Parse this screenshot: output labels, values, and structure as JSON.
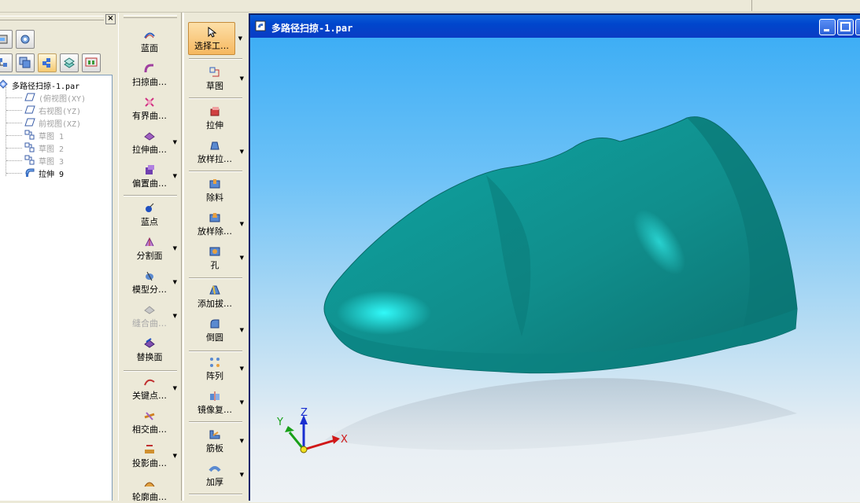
{
  "window": {
    "title": "多路径扫掠-1.par"
  },
  "pathfinder": {
    "tree": {
      "root": "多路径扫掠-1.par",
      "items": [
        {
          "label": "(俯视图(XY)",
          "dim": true,
          "icon": "plane-icon"
        },
        {
          "label": "右视图(YZ)",
          "dim": true,
          "icon": "plane-icon"
        },
        {
          "label": "前视图(XZ)",
          "dim": true,
          "icon": "plane-icon"
        },
        {
          "label": "草图 1",
          "dim": true,
          "icon": "sketch-icon"
        },
        {
          "label": "草图 2",
          "dim": true,
          "icon": "sketch-icon"
        },
        {
          "label": "草图 3",
          "dim": true,
          "icon": "sketch-icon"
        },
        {
          "label": "拉伸 9",
          "dim": false,
          "icon": "extrude-feature-icon"
        }
      ]
    }
  },
  "surface_toolbar": {
    "items": [
      {
        "label": "蓝面",
        "dropdown": false
      },
      {
        "label": "扫掠曲…",
        "dropdown": false
      },
      {
        "label": "有界曲…",
        "dropdown": false
      },
      {
        "label": "拉伸曲…",
        "dropdown": true
      },
      {
        "label": "偏置曲…",
        "dropdown": true
      },
      {
        "label": "蓝点",
        "dropdown": false
      },
      {
        "label": "分割面",
        "dropdown": true
      },
      {
        "label": "模型分…",
        "dropdown": true
      },
      {
        "label": "缝合曲…",
        "dropdown": true,
        "disabled": true
      },
      {
        "label": "替换面",
        "dropdown": false
      },
      {
        "label": "关键点…",
        "dropdown": true
      },
      {
        "label": "相交曲…",
        "dropdown": false
      },
      {
        "label": "投影曲…",
        "dropdown": true
      },
      {
        "label": "轮廓曲…",
        "dropdown": false
      }
    ]
  },
  "feature_toolbar": {
    "items": [
      {
        "label": "选择工…",
        "dropdown": true,
        "selected": true
      },
      {
        "label": "草图",
        "dropdown": true
      },
      {
        "label": "拉伸",
        "dropdown": false
      },
      {
        "label": "放样拉…",
        "dropdown": true
      },
      {
        "label": "除料",
        "dropdown": false
      },
      {
        "label": "放样除…",
        "dropdown": true
      },
      {
        "label": "孔",
        "dropdown": true
      },
      {
        "label": "添加拔…",
        "dropdown": false
      },
      {
        "label": "倒圆",
        "dropdown": true
      },
      {
        "label": "阵列",
        "dropdown": true
      },
      {
        "label": "镜像复…",
        "dropdown": true
      },
      {
        "label": "筋板",
        "dropdown": true
      },
      {
        "label": "加厚",
        "dropdown": true
      }
    ]
  },
  "triad": {
    "x": "X",
    "y": "Y",
    "z": "Z"
  },
  "colors": {
    "model": "#0f9a98",
    "title_bar": "#0a46cc",
    "selected_tool": "#f6b860"
  }
}
